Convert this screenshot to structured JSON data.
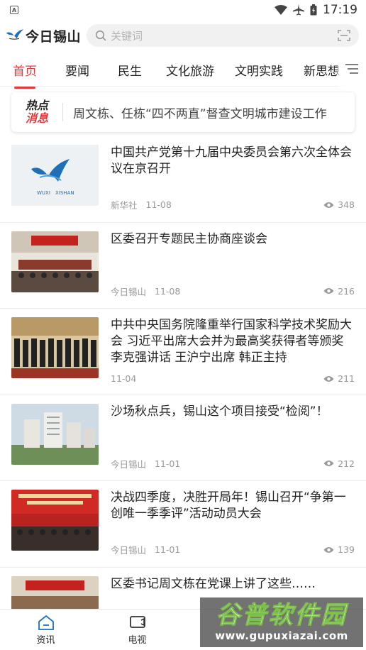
{
  "status_bar": {
    "time": "17:19"
  },
  "header": {
    "logo_text": "今日锡山",
    "search_placeholder": "关键词"
  },
  "tabs": [
    {
      "label": "首页"
    },
    {
      "label": "要闻"
    },
    {
      "label": "民生"
    },
    {
      "label": "文化旅游"
    },
    {
      "label": "文明实践"
    },
    {
      "label": "新思想"
    }
  ],
  "hot": {
    "badge_line1": "热点",
    "badge_line2": "消息",
    "text": "周文栋、任栋“四不两直”督查文明城市建设工作"
  },
  "news": [
    {
      "title": "中国共产党第十九届中央委员会第六次全体会议在京召开",
      "source": "新华社",
      "date": "11-08",
      "views": "348",
      "thumb": "logo"
    },
    {
      "title": "区委召开专题民主协商座谈会",
      "source": "今日锡山",
      "date": "11-08",
      "views": "216",
      "thumb": "meeting"
    },
    {
      "title": "中共中央国务院隆重举行国家科学技术奖励大会 习近平出席大会并为最高奖获得者等颁奖 李克强讲话 王沪宁出席 韩正主持",
      "source": "",
      "date": "11-04",
      "views": "211",
      "thumb": "group"
    },
    {
      "title": "沙场秋点兵，锡山这个项目接受“检阅”！",
      "source": "今日锡山",
      "date": "11-01",
      "views": "212",
      "thumb": "buildings"
    },
    {
      "title": "决战四季度，决胜开局年！锡山召开“争第一创唯一季季评”活动动员大会",
      "source": "今日锡山",
      "date": "11-01",
      "views": "139",
      "thumb": "stage"
    },
    {
      "title": "区委书记周文栋在党课上讲了这些……",
      "source": "",
      "date": "",
      "views": "",
      "thumb": "hall"
    }
  ],
  "bottom_nav": [
    {
      "label": "资讯",
      "icon": "home-icon"
    },
    {
      "label": "电视",
      "icon": "tv-icon"
    }
  ],
  "watermark": {
    "big": "谷普软件园",
    "small": "www.gupuxiazai.com"
  },
  "colors": {
    "accent": "#e4393c",
    "logo_blue": "#1e6fb8"
  }
}
